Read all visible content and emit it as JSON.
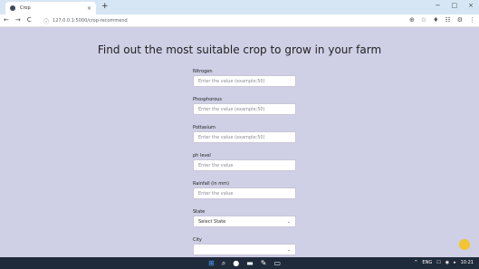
{
  "browser": {
    "tab_title": "Crop",
    "tab_close": "×",
    "new_tab": "+",
    "window_controls": [
      "−",
      "□",
      "×"
    ],
    "nav_back": "←",
    "nav_forward": "→",
    "nav_reload": "C",
    "address_info": "ⓘ",
    "url": "127.0.0.1:5000/crop-recommend",
    "toolbar_icons": [
      "⊕",
      "☆",
      "♦",
      "☷",
      "⚙",
      "⋮"
    ]
  },
  "page": {
    "heading": "Find out the most suitable crop to grow in your farm",
    "fields": [
      {
        "label": "Nitrogen",
        "placeholder": "Enter the value (example:50)"
      },
      {
        "label": "Phosphorous",
        "placeholder": "Enter the value (example:50)"
      },
      {
        "label": "Pottasium",
        "placeholder": "Enter the value (example:50)"
      },
      {
        "label": "ph level",
        "placeholder": "Enter the value"
      },
      {
        "label": "Rainfall (in mm)",
        "placeholder": "Enter the value"
      }
    ],
    "state": {
      "label": "State",
      "value": "Select State",
      "caret": "⌄"
    },
    "city": {
      "label": "City",
      "value": "",
      "caret": "⌄"
    }
  },
  "taskbar": {
    "start_icon": "⊞",
    "search_icon": "⌕",
    "apps": [
      "●",
      "▬",
      "✎",
      "▭"
    ],
    "tray": [
      "^",
      "ENG",
      "☐",
      "◉",
      "▸",
      "10:21"
    ]
  },
  "colors": {
    "page_background": "#cfcfe6",
    "tab_strip": "#d7e6f4",
    "taskbar": "#1f2b3a",
    "fab": "#f2c531"
  }
}
